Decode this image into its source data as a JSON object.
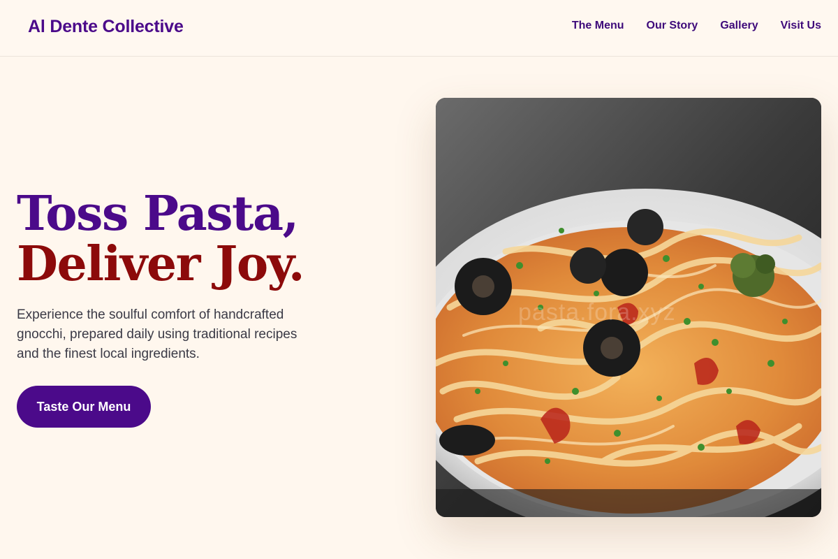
{
  "header": {
    "brand": "Al Dente Collective",
    "nav": [
      {
        "label": "The Menu"
      },
      {
        "label": "Our Story"
      },
      {
        "label": "Gallery"
      },
      {
        "label": "Visit Us"
      }
    ]
  },
  "hero": {
    "title_line1": "Toss Pasta,",
    "title_line2": "Deliver Joy.",
    "description": "Experience the soulful comfort of handcrafted gnocchi, prepared daily using traditional recipes and the finest local ingredients.",
    "cta_label": "Taste Our Menu",
    "image_watermark": "pasta.fora.xyz"
  },
  "colors": {
    "background": "#fff7ee",
    "brand_purple": "#4b0a8a",
    "accent_red": "#8c0a0a",
    "body_text": "#3a3a46"
  }
}
